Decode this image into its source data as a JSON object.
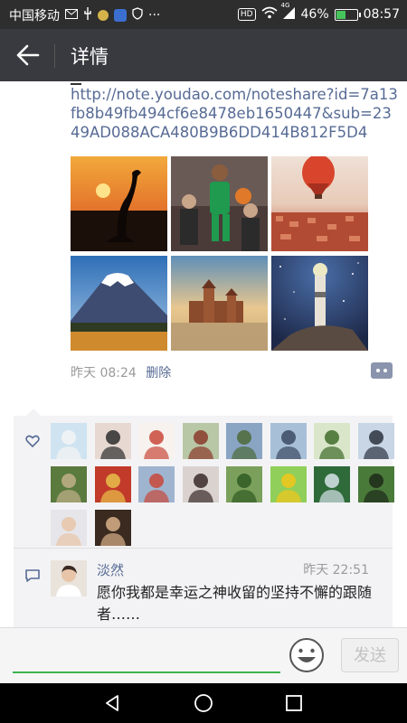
{
  "status_bar": {
    "carrier": "中国移动",
    "battery": "46%",
    "battery_level": 0.46,
    "time": "08:57",
    "network": "4G",
    "hd": "HD",
    "more": "···"
  },
  "header": {
    "title": "详情"
  },
  "post": {
    "link": "http://note.youdao.com/noteshare?id=7a13fb8b49fb494cf6e8478eb1650447&sub=2349AD088ACA480B9B6DD414B812F5D4",
    "time": "昨天 08:24",
    "delete_label": "删除",
    "photos": [
      "sunset-crane",
      "basketball-player",
      "hot-air-balloon-town",
      "mount-fuji",
      "castle-lake",
      "lighthouse-night"
    ]
  },
  "likes": {
    "count": 18
  },
  "comment": {
    "name": "淡然",
    "time": "昨天 22:51",
    "text": "愿你我都是幸运之神收留的坚持不懈的跟随者……"
  },
  "input": {
    "send_label": "发送"
  },
  "colors": {
    "header_bg": "#393a3f",
    "link": "#576b95",
    "accent_green": "#3db34a"
  }
}
